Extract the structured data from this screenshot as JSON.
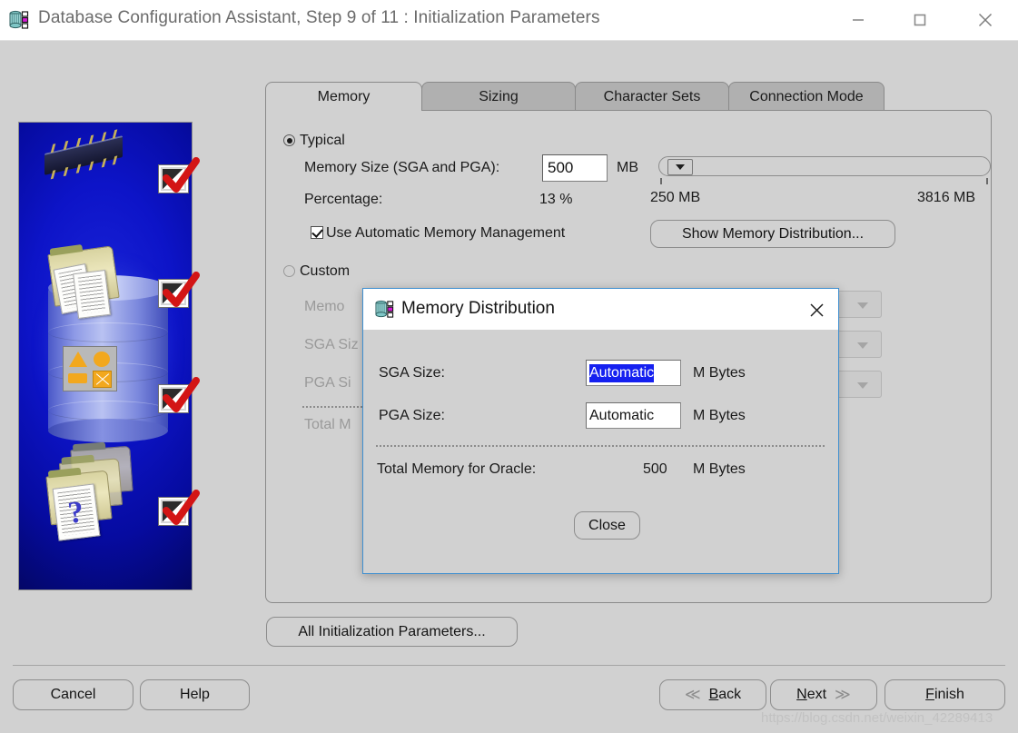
{
  "window": {
    "title": "Database Configuration Assistant, Step 9 of 11 : Initialization Parameters",
    "icon": "database-icon",
    "minimize_label": "—",
    "maximize_label": "□",
    "close_label": "✕"
  },
  "tabs": [
    {
      "label": "Memory",
      "active": true
    },
    {
      "label": "Sizing",
      "active": false
    },
    {
      "label": "Character Sets",
      "active": false
    },
    {
      "label": "Connection Mode",
      "active": false
    }
  ],
  "typical": {
    "radio_label": "Typical",
    "selected": true,
    "memory_size_label": "Memory Size (SGA and PGA):",
    "memory_size_value": "500",
    "memory_size_unit": "MB",
    "percentage_label": "Percentage:",
    "percentage_value": "13 %",
    "slider_min_label": "250 MB",
    "slider_max_label": "3816 MB",
    "amm_checkbox_label": "Use Automatic Memory Management",
    "amm_checked": true,
    "show_distribution_button": "Show Memory Distribution..."
  },
  "custom": {
    "radio_label": "Custom",
    "selected": false,
    "memory_label": "Memo",
    "sga_label": "SGA Siz",
    "pga_label": "PGA Si",
    "total_label": "Total M"
  },
  "dialog": {
    "title": "Memory Distribution",
    "icon": "database-icon",
    "close_label": "✕",
    "sga_label": "SGA Size:",
    "sga_value": "Automatic",
    "sga_unit": "M Bytes",
    "pga_label": "PGA Size:",
    "pga_value": "Automatic",
    "pga_unit": "M Bytes",
    "total_label": "Total Memory for Oracle:",
    "total_value": "500",
    "total_unit": "M Bytes",
    "close_button": "Close"
  },
  "footer": {
    "all_params_button": "All Initialization Parameters...",
    "cancel_button": "Cancel",
    "help_button": "Help",
    "back_button": "Back",
    "back_mnemonic": "B",
    "next_button": "Next",
    "next_mnemonic": "N",
    "finish_button": "Finish",
    "finish_mnemonic": "F",
    "back_arrow": "≪",
    "next_arrow": "≫"
  },
  "watermark": "https://blog.csdn.net/weixin_42289413",
  "colors": {
    "window_bg": "#d1d1d1",
    "titlebar_bg": "#ffffff",
    "tab_inactive": "#b0b0b0",
    "dialog_accent": "#3f8fd0",
    "selection_blue": "#1520f0",
    "art_blue": "#0d14c8",
    "check_red": "#d31515"
  }
}
